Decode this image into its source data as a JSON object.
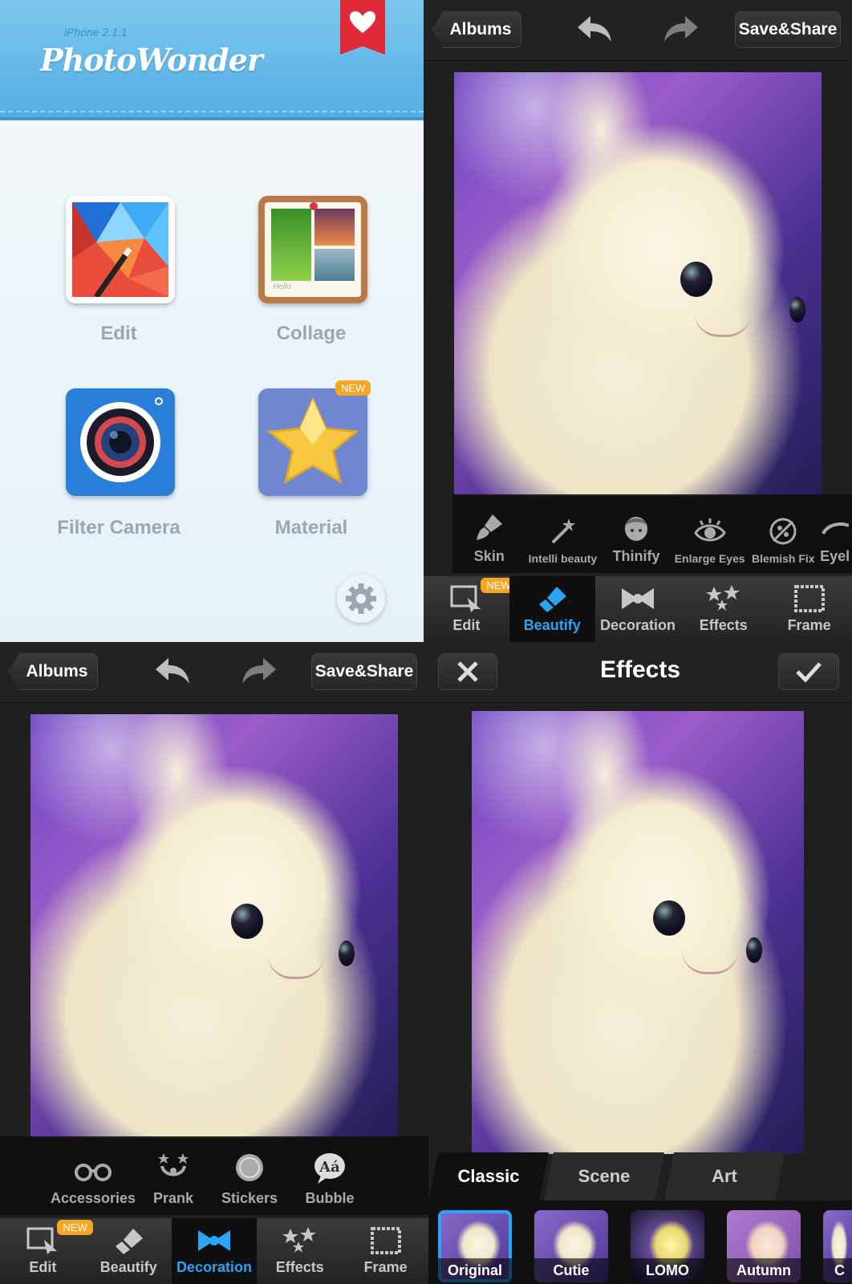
{
  "home": {
    "version": "iPhone 2.1.1",
    "logo": "PhotoWonder",
    "tiles": [
      {
        "label": "Edit"
      },
      {
        "label": "Collage"
      },
      {
        "label": "Filter Camera"
      },
      {
        "label": "Material",
        "badge": "NEW"
      }
    ],
    "collage_caption": "Hello"
  },
  "editor": {
    "albums_label": "Albums",
    "save_share_label": "Save&Share",
    "main_tabs": [
      {
        "label": "Edit",
        "badge": "NEW"
      },
      {
        "label": "Beautify"
      },
      {
        "label": "Decoration"
      },
      {
        "label": "Effects"
      },
      {
        "label": "Frame"
      }
    ]
  },
  "beautify": {
    "active_tab": "Beautify",
    "tools": [
      "Skin",
      "Intelli beauty",
      "Thinify",
      "Enlarge Eyes",
      "Blemish Fix",
      "Eyel"
    ]
  },
  "decoration": {
    "active_tab": "Decoration",
    "tools": [
      "Accessories",
      "Prank",
      "Stickers",
      "Bubble"
    ]
  },
  "effects": {
    "title": "Effects",
    "categories": [
      "Classic",
      "Scene",
      "Art"
    ],
    "active_category": "Classic",
    "filters": [
      "Original",
      "Cutie",
      "LOMO",
      "Autumn",
      "C"
    ],
    "selected_filter": "Original"
  },
  "colors": {
    "accent": "#2aa4f4",
    "badge": "#f5a623",
    "banner": "#5ab3e6",
    "ribbon": "#e02a3a"
  }
}
